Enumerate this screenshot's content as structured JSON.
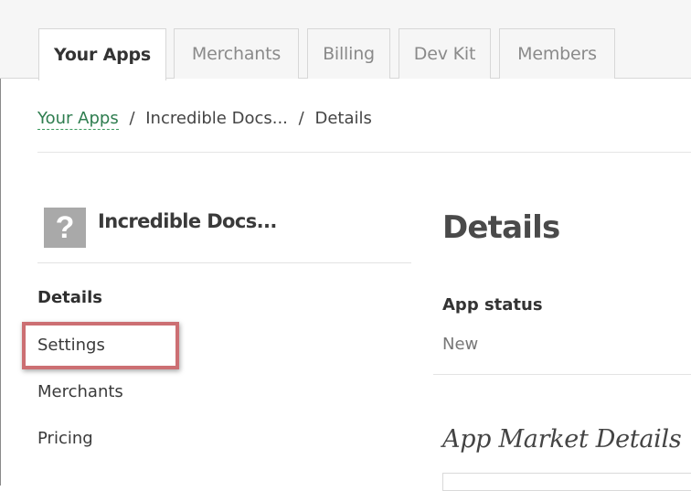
{
  "tabs": [
    {
      "label": "Your Apps",
      "active": true
    },
    {
      "label": "Merchants",
      "active": false
    },
    {
      "label": "Billing",
      "active": false
    },
    {
      "label": "Dev Kit",
      "active": false
    },
    {
      "label": "Members",
      "active": false
    }
  ],
  "breadcrumb": {
    "items": [
      "Your Apps",
      "Incredible Docs...",
      "Details"
    ],
    "separator": "/"
  },
  "app": {
    "icon_glyph": "?",
    "name": "Incredible Docs..."
  },
  "sidenav": {
    "items": [
      "Details",
      "Settings",
      "Merchants",
      "Pricing"
    ],
    "active": "Details",
    "highlighted": "Settings",
    "highlight_color": "#cc6f73"
  },
  "main": {
    "heading": "Details",
    "status_label": "App status",
    "status_value": "New",
    "market_heading": "App Market Details"
  },
  "colors": {
    "link": "#2e7d4f",
    "tabbar_bg": "#f6f6f6"
  }
}
